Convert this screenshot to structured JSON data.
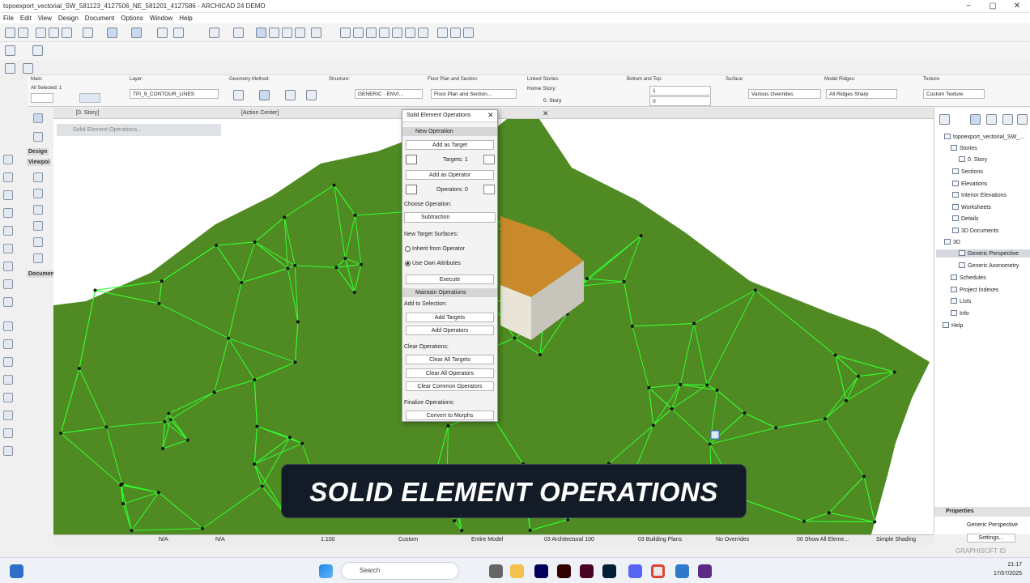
{
  "window": {
    "title": "topoexport_vectorial_SW_581123_4127506_NE_581201_4127586 - ARCHICAD 24 DEMO",
    "minimize": "−",
    "maximize": "▢",
    "close": "✕"
  },
  "menu": [
    "File",
    "Edit",
    "View",
    "Design",
    "Document",
    "Options",
    "Window",
    "Help"
  ],
  "infobox": {
    "main_label": "Main:",
    "all_selected": "All Selected: 1",
    "layer_label": "Layer:",
    "layer_value": "TPI_9_CONTOUR_LINES",
    "geometry_label": "Geometry Method:",
    "structure_label": "Structure:",
    "structure_value": "GENERIC - ENVI...",
    "floorplan_label": "Floor Plan and Section:",
    "floorplan_value": "Floor Plan and Section...",
    "linked_label": "Linked Stories:",
    "home_story_label": "Home Story:",
    "home_story_value": "0. Story",
    "bottom_top_label": "Bottom and Top:",
    "top_value": "1",
    "bottom_value": "0",
    "surface_label": "Surface:",
    "surface_value": "Various Overrides",
    "ridges_label": "Model Ridges:",
    "ridges_value": "All Ridges Sharp",
    "texture_label": "Texture:",
    "texture_value": "Custom Texture"
  },
  "tabs": {
    "story": "[0. Story]",
    "action_center": "[Action Center]"
  },
  "left_toolbox": {
    "design": "Design",
    "viewpoint": "Viewpoi",
    "document": "Documen"
  },
  "hint": "Solid Element Operations...",
  "dialog": {
    "title": "Solid Element Operations",
    "new_operation": "New Operation",
    "add_as_target": "Add as Target",
    "targets": "Targets: 1",
    "add_as_operator": "Add as Operator",
    "operators": "Operators: 0",
    "choose_operation": "Choose Operation:",
    "operation_value": "Subtraction",
    "new_target_surfaces": "New Target Surfaces:",
    "inherit": "Inherit from Operator",
    "use_own": "Use Own Attributes",
    "execute": "Execute",
    "maintain": "Maintain Operations",
    "add_to_selection": "Add to Selection:",
    "add_targets": "Add Targets",
    "add_operators": "Add Operators",
    "clear_operations": "Clear Operations:",
    "clear_all_targets": "Clear All Targets",
    "clear_all_operators": "Clear All Operators",
    "clear_common_operators": "Clear Common Operators",
    "finalize": "Finalize Operations:",
    "convert_to_morphs": "Convert to Morphs"
  },
  "navigator": {
    "project": "topoexport_vectorial_SW_...",
    "stories": "Stories",
    "story0": "0. Story",
    "sections": "Sections",
    "elevations": "Elevations",
    "interior_elevations": "Interior Elevations",
    "worksheets": "Worksheets",
    "details": "Details",
    "documents_3d": "3D Documents",
    "d3": "3D",
    "generic_perspective": "Generic Perspective",
    "generic_axonometry": "Generic Axonometry",
    "schedules": "Schedules",
    "project_indexes": "Project Indexes",
    "lists": "Lists",
    "info": "Info",
    "help": "Help",
    "properties": "Properties",
    "properties_value": "Generic Perspective",
    "settings": "Settings..."
  },
  "statusbar": {
    "na1": "N/A",
    "na2": "N/A",
    "scale": "1:100",
    "custom": "Custom",
    "entire_model": "Entire Model",
    "arch": "03 Architectural 100",
    "plans": "03 Building Plans",
    "overrides": "No Overrides",
    "show_all": "00 Show All Eleme...",
    "shading": "Simple Shading"
  },
  "graphisoft": "GRAPHISOFT ID",
  "caption": "SOLID ELEMENT OPERATIONS",
  "taskbar": {
    "search": "Search",
    "time": "21:17",
    "date": "17/07/2025"
  },
  "colors": {
    "terrain": "#4f8a22",
    "mesh": "#33ff33",
    "caption_bg": "#131b27",
    "dialog_header": "#d6d6d6"
  }
}
